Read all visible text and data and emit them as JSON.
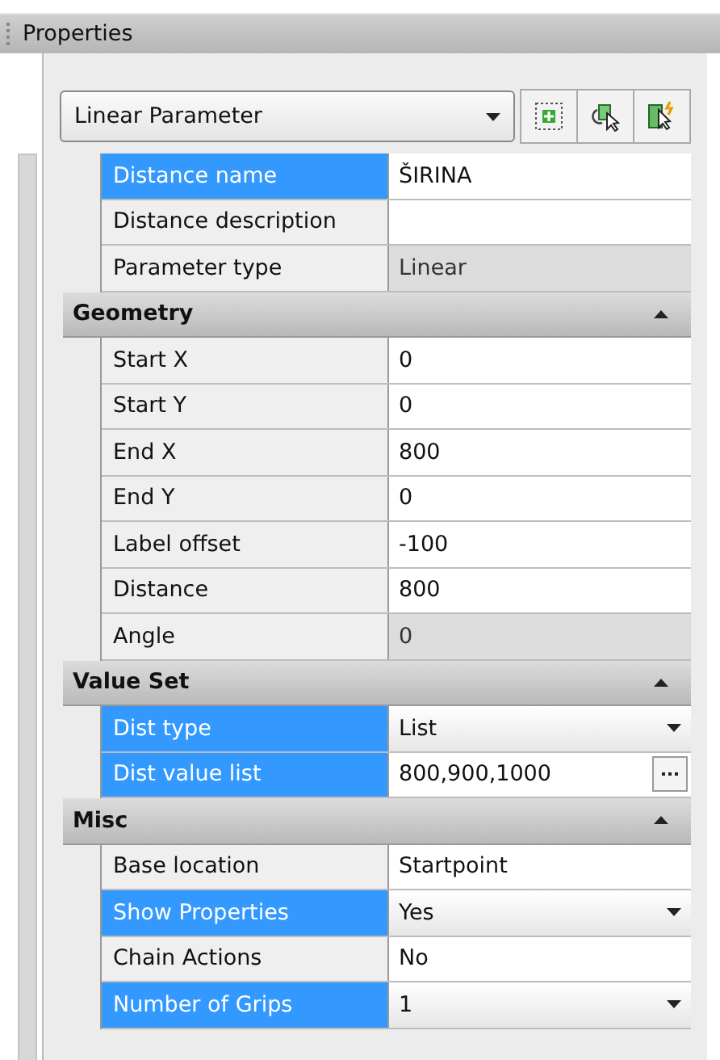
{
  "window": {
    "title": "Properties"
  },
  "selector": {
    "value": "Linear Parameter"
  },
  "top_rows": [
    {
      "label": "Distance name",
      "value": "ŠIRINA",
      "selected": true,
      "readonly": false
    },
    {
      "label": "Distance description",
      "selected": false,
      "readonly": false
    },
    {
      "label": "Parameter type",
      "value": "Linear",
      "selected": false,
      "readonly": true
    }
  ],
  "sections": [
    {
      "title": "Geometry",
      "expanded": true,
      "rows": [
        {
          "label": "Start X",
          "value": "0",
          "kind": "text",
          "selected": false,
          "readonly": false
        },
        {
          "label": "Start Y",
          "value": "0",
          "kind": "text",
          "selected": false,
          "readonly": false
        },
        {
          "label": "End X",
          "value": "800",
          "kind": "text",
          "selected": false,
          "readonly": false
        },
        {
          "label": "End Y",
          "value": "0",
          "kind": "text",
          "selected": false,
          "readonly": false
        },
        {
          "label": "Label offset",
          "value": "-100",
          "kind": "text",
          "selected": false,
          "readonly": false
        },
        {
          "label": "Distance",
          "value": "800",
          "kind": "text",
          "selected": false,
          "readonly": false
        },
        {
          "label": "Angle",
          "value": "0",
          "kind": "text",
          "selected": false,
          "readonly": true
        }
      ]
    },
    {
      "title": "Value Set",
      "expanded": true,
      "rows": [
        {
          "label": "Dist type",
          "value": "List",
          "kind": "dropdown",
          "selected": true,
          "readonly": false
        },
        {
          "label": "Dist value list",
          "value": "800,900,1000",
          "kind": "browse",
          "selected": true,
          "readonly": false
        }
      ]
    },
    {
      "title": "Misc",
      "expanded": true,
      "rows": [
        {
          "label": "Base location",
          "value": "Startpoint",
          "kind": "text",
          "selected": false,
          "readonly": false
        },
        {
          "label": "Show Properties",
          "value": "Yes",
          "kind": "dropdown",
          "selected": true,
          "readonly": false
        },
        {
          "label": "Chain Actions",
          "value": "No",
          "kind": "text",
          "selected": false,
          "readonly": false
        },
        {
          "label": "Number of Grips",
          "value": "1",
          "kind": "dropdown",
          "selected": true,
          "readonly": false
        }
      ]
    }
  ]
}
